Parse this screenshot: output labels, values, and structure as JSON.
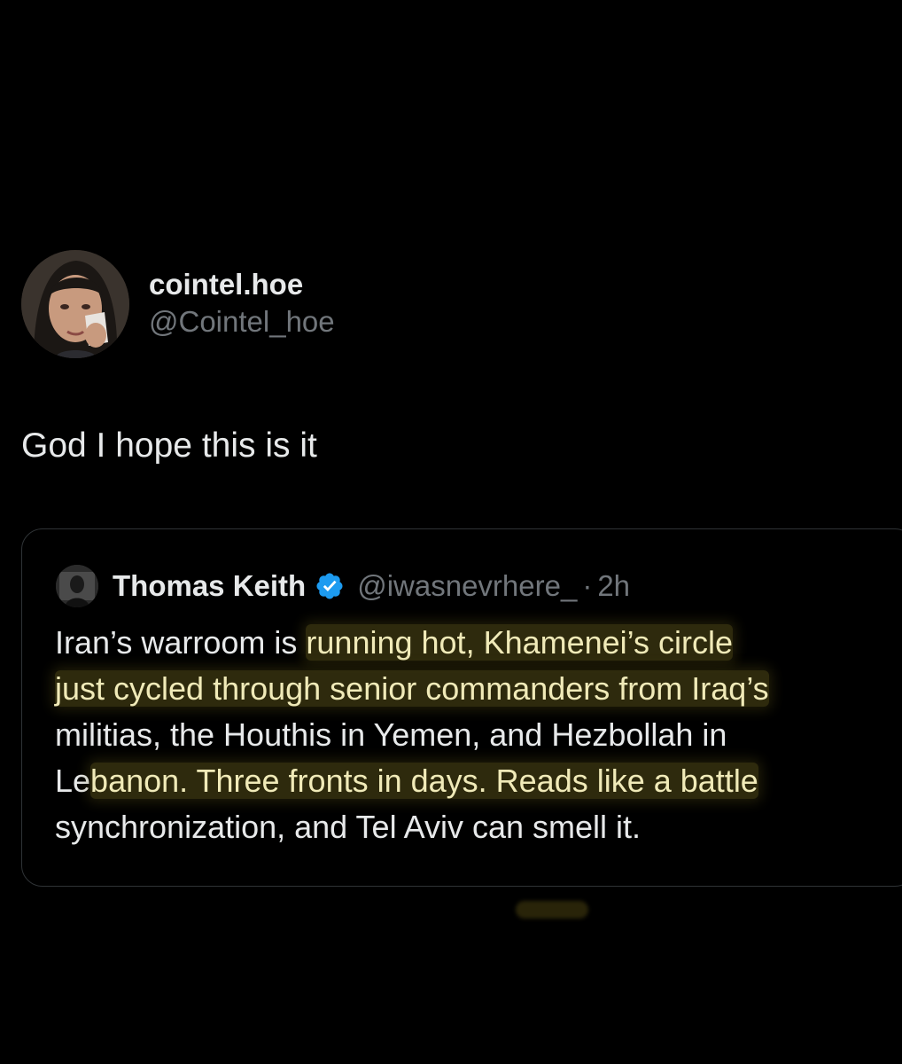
{
  "tweet": {
    "display_name": "cointel.hoe",
    "handle": "@Cointel_hoe",
    "text": "God I hope this is it",
    "avatar_icon": "profile-photo"
  },
  "quoted_tweet": {
    "display_name": "Thomas Keith",
    "handle": "@iwasnevrhere_",
    "separator": "·",
    "time": "2h",
    "verified_icon": "verified-badge-icon",
    "body_lines": [
      {
        "plain": "Iran’s warroom is ",
        "highlight": "running hot, Khamenei’s circle"
      },
      {
        "plain": "",
        "highlight": "just cycled through senior commanders from Iraq’s"
      },
      {
        "plain": "militias, the Houthis in Yemen, and Hezbollah in",
        "highlight": ""
      },
      {
        "plain": "Le",
        "highlight": "banon. Three fronts in days. Reads like a  battle"
      },
      {
        "plain": "synchronization, and Tel Aviv can smell it.",
        "highlight": ""
      }
    ]
  },
  "colors": {
    "background": "#000000",
    "primary_text": "#e7e9ea",
    "secondary_text": "#71767b",
    "verified_blue": "#1d9bf0",
    "card_border": "#2f3336",
    "highlight": "#6e641e"
  }
}
